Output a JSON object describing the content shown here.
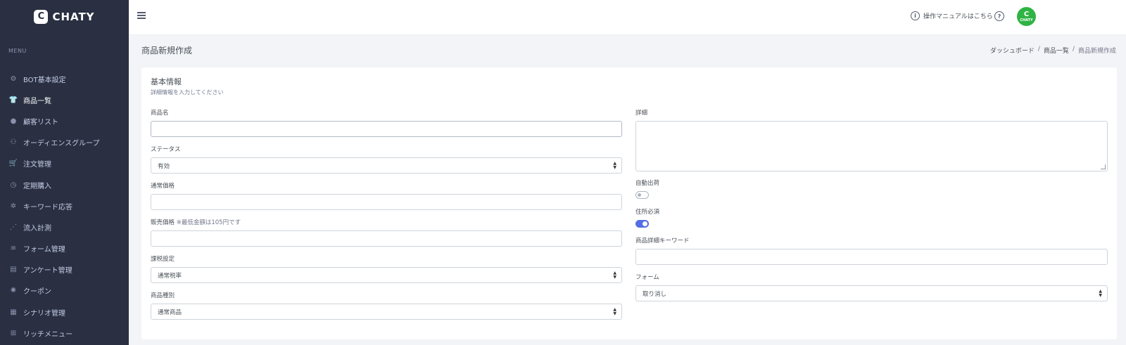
{
  "brand": {
    "name": "CHATY",
    "mark": "C"
  },
  "sidebar": {
    "menu_title": "MENU",
    "items": [
      {
        "label": "BOT基本設定",
        "icon": "robot-icon",
        "glyph": "⚙",
        "active": false
      },
      {
        "label": "商品一覧",
        "icon": "shirt-icon",
        "glyph": "👕",
        "active": true
      },
      {
        "label": "顧客リスト",
        "icon": "user-icon",
        "glyph": "●",
        "active": false
      },
      {
        "label": "オーディエンスグループ",
        "icon": "group-icon",
        "glyph": "⚇",
        "active": false
      },
      {
        "label": "注文管理",
        "icon": "cart-icon",
        "glyph": "🛒",
        "active": false
      },
      {
        "label": "定期購入",
        "icon": "clock-icon",
        "glyph": "◷",
        "active": false
      },
      {
        "label": "キーワード応答",
        "icon": "cog-icon",
        "glyph": "✲",
        "active": false
      },
      {
        "label": "流入計測",
        "icon": "chart-icon",
        "glyph": "⋰",
        "active": false
      },
      {
        "label": "フォーム管理",
        "icon": "form-icon",
        "glyph": "≡",
        "active": false
      },
      {
        "label": "アンケート管理",
        "icon": "document-icon",
        "glyph": "▤",
        "active": false
      },
      {
        "label": "クーポン",
        "icon": "coupon-icon",
        "glyph": "✺",
        "active": false
      },
      {
        "label": "シナリオ管理",
        "icon": "scenario-icon",
        "glyph": "▦",
        "active": false
      },
      {
        "label": "リッチメニュー",
        "icon": "grid-icon",
        "glyph": "⊞",
        "active": false
      }
    ]
  },
  "header": {
    "manual_label": "操作マニュアルはこちら",
    "avatar_label": "CHATY"
  },
  "page": {
    "title": "商品新規作成",
    "breadcrumb": [
      "ダッシュボード",
      "商品一覧",
      "商品新規作成"
    ]
  },
  "form": {
    "card_title": "基本情報",
    "card_subtitle": "詳細情報を入力してください",
    "product_name_label": "商品名",
    "product_name_value": "",
    "status_label": "ステータス",
    "status_value": "有効",
    "regular_price_label": "通常価格",
    "regular_price_value": "",
    "sale_price_label": "販売価格",
    "sale_price_note": "※最低金額は105円です",
    "sale_price_value": "",
    "tax_label": "課税設定",
    "tax_value": "通常税率",
    "type_label": "商品種別",
    "type_value": "通常商品",
    "detail_label": "詳細",
    "auto_ship_label": "自動出荷",
    "auto_ship_on": false,
    "address_required_label": "住所必須",
    "address_required_on": true,
    "keyword_label": "商品詳細キーワード",
    "keyword_value": "",
    "form_label": "フォーム",
    "form_value": "取り消し"
  },
  "colors": {
    "sidebar_bg": "#2a3042",
    "accent": "#556ee6",
    "avatar": "#2fb344"
  }
}
